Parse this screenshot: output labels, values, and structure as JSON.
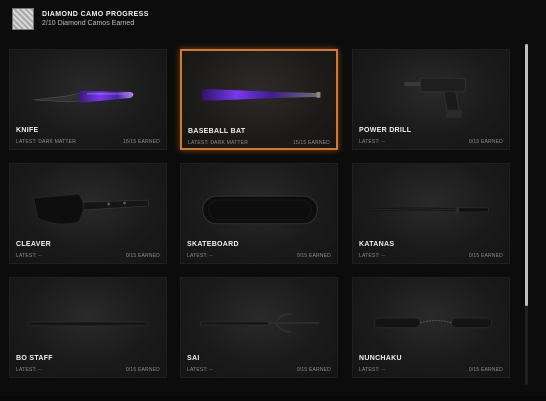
{
  "header": {
    "title": "DIAMOND CAMO PROGRESS",
    "subtitle": "2/10 Diamond Camos Earned"
  },
  "cards": [
    {
      "name": "KNIFE",
      "latest": "LATEST: DARK MATTER",
      "earned": "15/15 EARNED",
      "icon": "knife-icon"
    },
    {
      "name": "BASEBALL BAT",
      "latest": "LATEST: DARK MATTER",
      "earned": "15/15 EARNED",
      "icon": "baseball-bat-icon",
      "selected": true
    },
    {
      "name": "POWER DRILL",
      "latest": "LATEST: --",
      "earned": "0/15 EARNED",
      "icon": "power-drill-icon"
    },
    {
      "name": "CLEAVER",
      "latest": "LATEST: --",
      "earned": "0/15 EARNED",
      "icon": "cleaver-icon"
    },
    {
      "name": "SKATEBOARD",
      "latest": "LATEST: --",
      "earned": "0/15 EARNED",
      "icon": "skateboard-icon"
    },
    {
      "name": "KATANAS",
      "latest": "LATEST: --",
      "earned": "0/15 EARNED",
      "icon": "katana-icon"
    },
    {
      "name": "BO STAFF",
      "latest": "LATEST: --",
      "earned": "0/15 EARNED",
      "icon": "bo-staff-icon"
    },
    {
      "name": "SAI",
      "latest": "LATEST: --",
      "earned": "0/15 EARNED",
      "icon": "sai-icon"
    },
    {
      "name": "NUNCHAKU",
      "latest": "LATEST: --",
      "earned": "0/15 EARNED",
      "icon": "nunchaku-icon"
    }
  ],
  "colors": {
    "accent_selected": "#d4782a",
    "dark_matter_purple": "#6a2bd6",
    "background": "#0c0c0c"
  }
}
